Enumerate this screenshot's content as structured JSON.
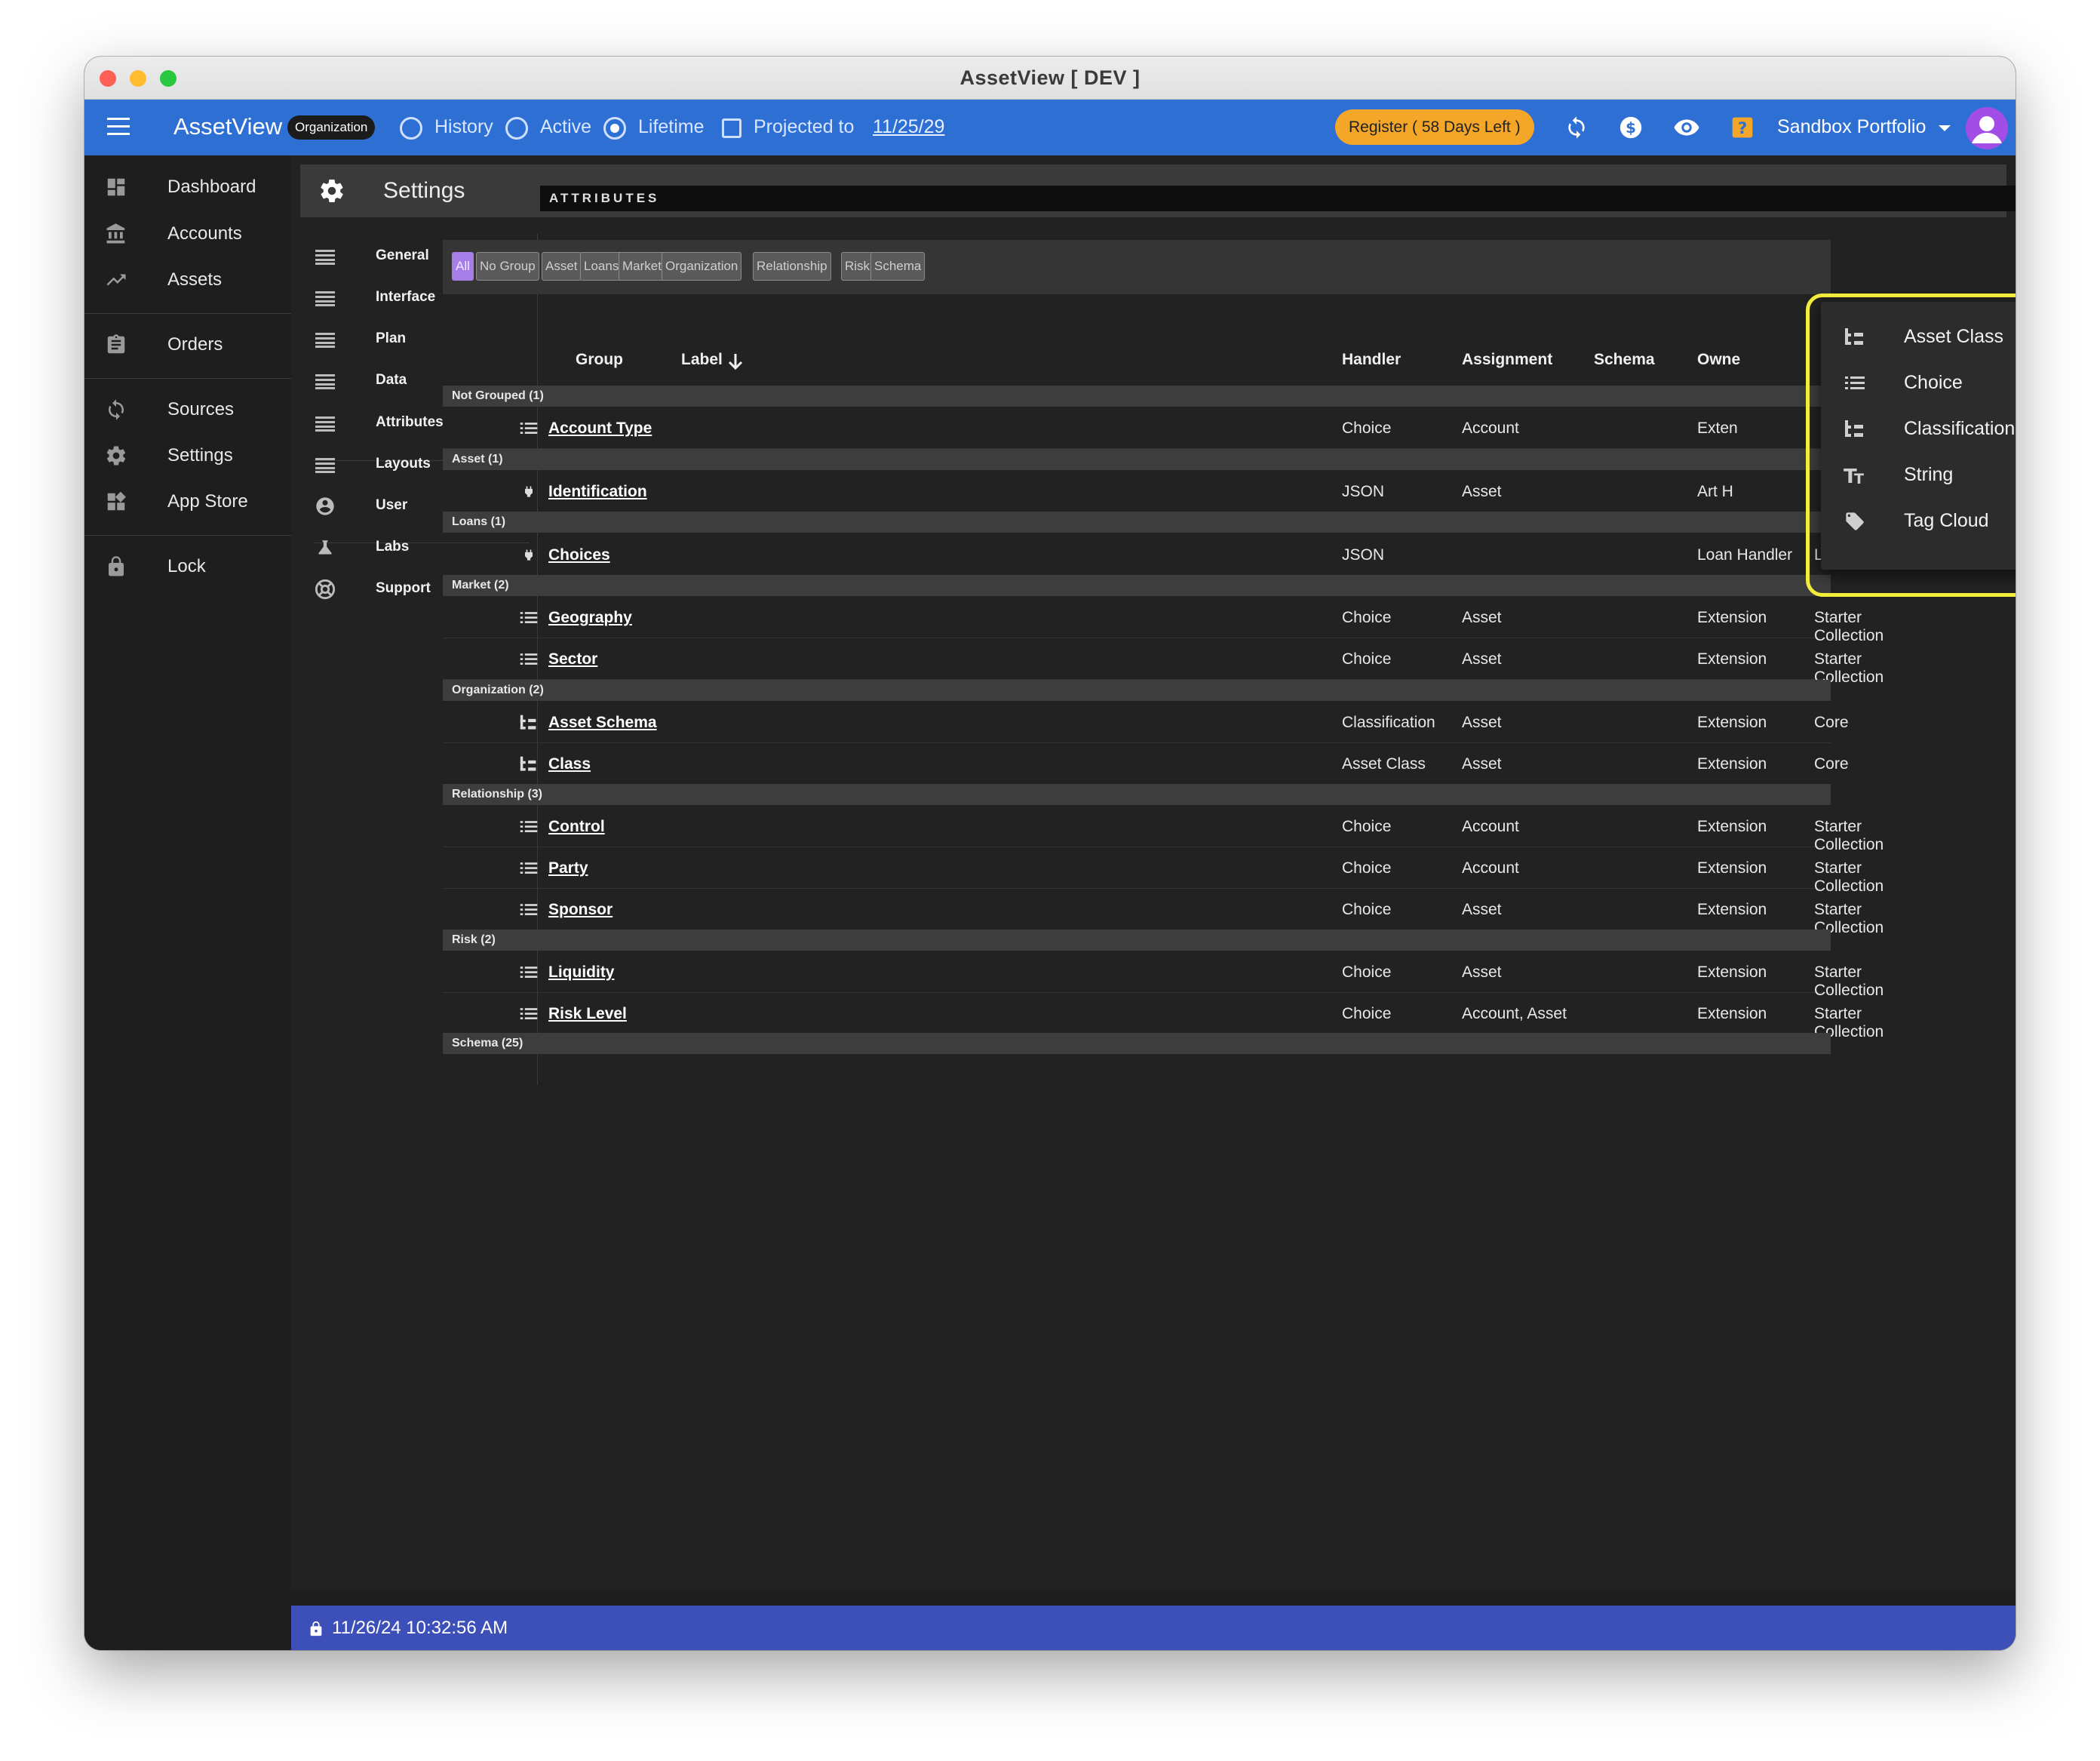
{
  "window": {
    "title": "AssetView [ DEV ]"
  },
  "appbar": {
    "brand": "AssetView",
    "org_badge": "Organization",
    "radio_history": "History",
    "radio_active": "Active",
    "radio_lifetime": "Lifetime",
    "projected_label": "Projected to",
    "projected_date": "11/25/29",
    "register": "Register ( 58 Days Left )",
    "portfolio": "Sandbox Portfolio"
  },
  "sidebar": {
    "items": [
      {
        "label": "Dashboard",
        "icon": "dashboard-icon"
      },
      {
        "label": "Accounts",
        "icon": "bank-icon"
      },
      {
        "label": "Assets",
        "icon": "trend-icon"
      },
      {
        "label": "Orders",
        "icon": "clipboard-icon"
      },
      {
        "label": "Sources",
        "icon": "sync-icon"
      },
      {
        "label": "Settings",
        "icon": "gear-icon"
      },
      {
        "label": "App Store",
        "icon": "widgets-icon"
      },
      {
        "label": "Lock",
        "icon": "lock-icon"
      }
    ]
  },
  "settings": {
    "title": "Settings",
    "subnav": [
      {
        "label": "General"
      },
      {
        "label": "Interface"
      },
      {
        "label": "Plan"
      },
      {
        "label": "Data"
      },
      {
        "label": "Attributes"
      },
      {
        "label": "Layouts"
      },
      {
        "label": "User"
      },
      {
        "label": "Labs"
      },
      {
        "label": "Support"
      }
    ]
  },
  "attributes": {
    "header": "ATTRIBUTES",
    "filters": [
      "All",
      "No Group",
      "Asset",
      "Loans",
      "Market",
      "Organization",
      "Relationship",
      "Risk",
      "Schema"
    ],
    "columns": {
      "group": "Group",
      "label": "Label",
      "handler": "Handler",
      "assignment": "Assignment",
      "schema": "Schema",
      "owner": "Owne"
    },
    "groups": [
      {
        "name": "Not Grouped (1)"
      },
      {
        "name": "Asset (1)"
      },
      {
        "name": "Loans (1)"
      },
      {
        "name": "Market (2)"
      },
      {
        "name": "Organization (2)"
      },
      {
        "name": "Relationship (3)"
      },
      {
        "name": "Risk (2)"
      },
      {
        "name": "Schema (25)"
      }
    ],
    "rows": [
      {
        "label": "Account Type",
        "handler": "Choice",
        "assignment": "Account",
        "owner": "Exten",
        "source": "",
        "icon": "list-icon"
      },
      {
        "label": "Identification",
        "handler": "JSON",
        "assignment": "Asset",
        "owner": "Art H",
        "source": "",
        "icon": "plug-icon"
      },
      {
        "label": "Choices",
        "handler": "JSON",
        "assignment": "",
        "owner": "Loan Handler",
        "source": "Loans",
        "icon": "plug-icon"
      },
      {
        "label": "Geography",
        "handler": "Choice",
        "assignment": "Asset",
        "owner": "Extension",
        "source": "Starter Collection",
        "icon": "list-icon"
      },
      {
        "label": "Sector",
        "handler": "Choice",
        "assignment": "Asset",
        "owner": "Extension",
        "source": "Starter Collection",
        "icon": "list-icon"
      },
      {
        "label": "Asset Schema",
        "handler": "Classification",
        "assignment": "Asset",
        "owner": "Extension",
        "source": "Core",
        "icon": "tree-icon"
      },
      {
        "label": "Class",
        "handler": "Asset Class",
        "assignment": "Asset",
        "owner": "Extension",
        "source": "Core",
        "icon": "tree-icon"
      },
      {
        "label": "Control",
        "handler": "Choice",
        "assignment": "Account",
        "owner": "Extension",
        "source": "Starter Collection",
        "icon": "list-icon"
      },
      {
        "label": "Party",
        "handler": "Choice",
        "assignment": "Account",
        "owner": "Extension",
        "source": "Starter Collection",
        "icon": "list-icon"
      },
      {
        "label": "Sponsor",
        "handler": "Choice",
        "assignment": "Asset",
        "owner": "Extension",
        "source": "Starter Collection",
        "icon": "list-icon"
      },
      {
        "label": "Liquidity",
        "handler": "Choice",
        "assignment": "Asset",
        "owner": "Extension",
        "source": "Starter Collection",
        "icon": "list-icon"
      },
      {
        "label": "Risk Level",
        "handler": "Choice",
        "assignment": "Account, Asset",
        "owner": "Extension",
        "source": "Starter Collection",
        "icon": "list-icon"
      }
    ]
  },
  "add_menu": {
    "plus": "+",
    "items": [
      {
        "label": "Asset Class",
        "icon": "tree-icon"
      },
      {
        "label": "Choice",
        "icon": "list-icon"
      },
      {
        "label": "Classification",
        "icon": "tree-icon"
      },
      {
        "label": "String",
        "icon": "text-icon"
      },
      {
        "label": "Tag Cloud",
        "icon": "tag-icon"
      }
    ]
  },
  "statusbar": {
    "timestamp": "11/26/24 10:32:56 AM"
  },
  "colors": {
    "appbar": "#2e6fd4",
    "statusbar": "#3d4fb8",
    "register": "#f3a628",
    "highlight": "#f2ec3c",
    "plus": "#e0376b",
    "chip_active": "#a77de8"
  }
}
